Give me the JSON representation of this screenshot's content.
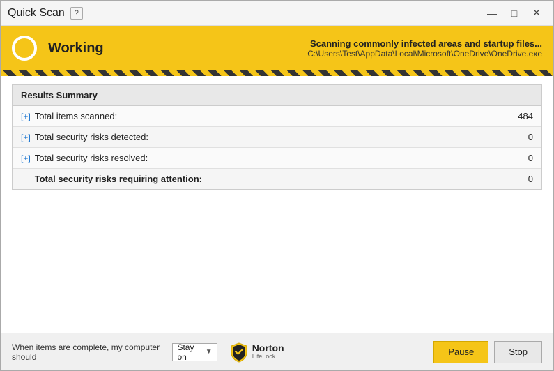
{
  "window": {
    "title": "Quick Scan",
    "help_label": "?",
    "controls": {
      "minimize": "—",
      "maximize": "□",
      "close": "✕"
    }
  },
  "status": {
    "label": "Working",
    "scanning_text": "Scanning commonly infected areas and startup files...",
    "file_text": "C:\\Users\\Test\\AppData\\Local\\Microsoft\\OneDrive\\OneDrive.exe"
  },
  "results": {
    "header": "Results Summary",
    "rows": [
      {
        "expand": "[+]",
        "label": "Total items scanned:",
        "value": "484",
        "bold": false
      },
      {
        "expand": "[+]",
        "label": "Total security risks detected:",
        "value": "0",
        "bold": false
      },
      {
        "expand": "[+]",
        "label": "Total security risks resolved:",
        "value": "0",
        "bold": false
      },
      {
        "expand": "",
        "label": "Total security risks requiring attention:",
        "value": "0",
        "bold": true
      }
    ]
  },
  "footer": {
    "label": "When items are complete, my computer should",
    "select_value": "Stay on",
    "buttons": {
      "pause": "Pause",
      "stop": "Stop"
    }
  },
  "norton": {
    "name": "Norton",
    "sub": "LifeLock"
  }
}
